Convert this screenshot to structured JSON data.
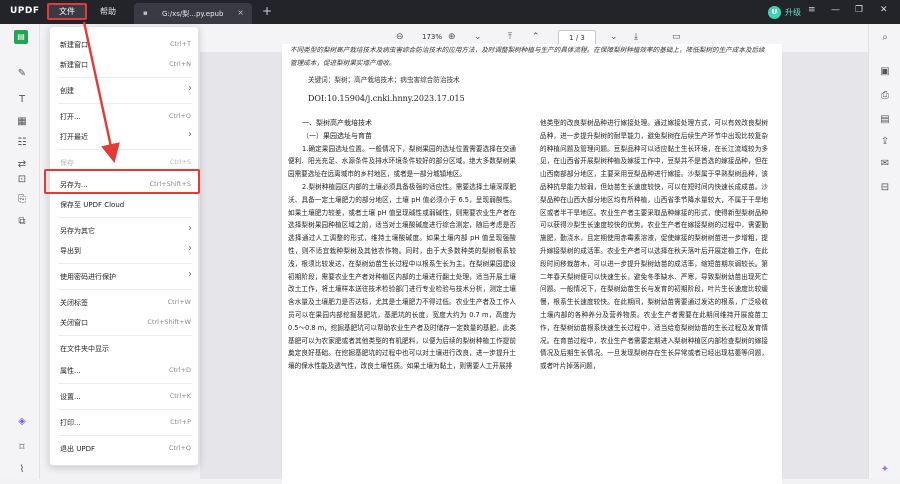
{
  "app": {
    "logo": "UPDF"
  },
  "menubar": {
    "file": "文件",
    "help": "帮助"
  },
  "tab": {
    "title": "G:/xs/梨...py.epub",
    "close": "×",
    "add": "+"
  },
  "account": {
    "initial": "U",
    "upgrade": "升级"
  },
  "toolbar": {
    "zoom": "173%",
    "page": "1  /  3"
  },
  "file_menu": {
    "items": [
      {
        "label": "新建窗口",
        "shortcut": "Ctrl+T"
      },
      {
        "label": "新建窗口",
        "shortcut": "Ctrl+N"
      },
      {
        "label": "创建",
        "shortcut": ""
      },
      {
        "label": "打开...",
        "shortcut": "Ctrl+O"
      },
      {
        "label": "打开最近",
        "shortcut": ""
      },
      {
        "label": "保存",
        "shortcut": "Ctrl+S"
      },
      {
        "label": "另存为...",
        "shortcut": "Ctrl+Shift+S"
      },
      {
        "label": "保存至 UPDF Cloud",
        "shortcut": ""
      },
      {
        "label": "另存为其它",
        "shortcut": ""
      },
      {
        "label": "导出到",
        "shortcut": ""
      },
      {
        "label": "使用密码进行保护",
        "shortcut": ""
      },
      {
        "label": "关闭标签",
        "shortcut": "Ctrl+W"
      },
      {
        "label": "关闭窗口",
        "shortcut": "Ctrl+Shift+W"
      },
      {
        "label": "在文件夹中显示",
        "shortcut": ""
      },
      {
        "label": "属性...",
        "shortcut": "Ctrl+D"
      },
      {
        "label": "设置...",
        "shortcut": "Ctrl+K"
      },
      {
        "label": "打印...",
        "shortcut": "Ctrl+P"
      },
      {
        "label": "退出 UPDF",
        "shortcut": "Ctrl+Q"
      }
    ]
  },
  "document": {
    "abstract": "不同类型的梨树高产栽培技术及病虫害综合防治技术的应用方法，及时调整梨树种植与生产的具体流程。在保障梨树种植效率的基础上，降低梨树的生产成本及后续管理成本，促进梨树果实增产增收。",
    "keywords": "关键词：梨树；高产栽培技术；病虫害综合防治技术",
    "doi": "DOI:10.15904/j.cnki.hnny.2023.17.015",
    "left_col": [
      "一、梨树高产栽培技术",
      "（一）果园选址与育苗",
      "1.确定果园选址位置。一般情况下，梨树果园的选址位置需要选择在交通便利、阳光充足、水源条件及排水环境条件较好的部分区域。绝大多数梨树果园需要选址在远离城市的乡村地区，或者是一部分城镇地区。",
      "2.梨树种植园区内部的土壤必须具备极强的适应性。需要选择土壤深厚肥沃、具备一定土壤肥力的部分地区，土壤 pH 值必须小于 6.5，呈现弱酸性。如果土壤肥力较差，或者土壤 pH 值呈现碱性或弱碱性，则需要农业生产者在选择梨树果园种植区域之前，适当对土壤酸碱度进行综合测定，随后考虑是否选择通过人工调整的形式，维持土壤酸碱度。如果土壤内部 pH 值呈现强酸性，则不适宜栽种梨树及其他农作物。同时，由于大多数种类的梨树根系较浅，根须比较发达，在梨树幼苗生长过程中以根系生长为主。在梨树果园建设初期阶段，需要农业生产者对种植区内部的土壤进行翻土处理，适当开展土壤改土工作，将土壤样本送往技术检验部门进行专业检验与技术分析，测定土壤含水量及土壤肥力是否达标，尤其是土壤肥力不得过低。农业生产者及工作人员可以在果园内部挖掘基肥坑，基肥坑的长度，宽度大约为 0.7 m，高度为 0.5～0.8 m，挖掘基肥坑可以帮助农业生产者及时储存一定数量的基肥，此类基肥可以为农家肥或者其他类型的有机肥料，以便为后续的梨树种植工作提前奠定良好基础。在挖掘基肥坑的过程中也可以对土壤进行改良，进一步提升土壤的保水性能及透气性，改良土壤性质。如果土壤为黏土，则需要人工开展排"
    ],
    "right_col": [
      "他类型的改良梨树品种进行嫁接处理。通过嫁接处理方式，可以有效改良梨树品种，进一步提升梨树的耐旱能力，避免梨树在后续生产环节中出现比较复杂的种植问题及管理问题。豆梨品种可以适应黏土生长环境，在长江流域较为多见，在山西省开展梨树种植及嫁接工作中，豆梨并不是首选的嫁接品种，但在山西南部部分地区，主要采用豆梨品种进行嫁接。沙梨属于早熟梨树品种，该品种抗旱能力较弱，但幼苗生长速度较快，可以在短时间内快速长成成苗。沙梨品种在山西大部分地区均有所种植，山西省季节降水量较大，不属于干旱地区或者半干旱地区。农业生产者主要采取品种嫁接的形式，使得新型梨树品种可以获得沙梨生长速度较快的优势。农业生产者在嫁接梨树的过程中，需要勤施肥，勤浇水，且定期使用赤霉素溶液，促使嫁接的梨树树苗进一步增粗，提升嫁接梨树的成活率。农业生产者可以选择在秋天落叶后开展定植工作，在此段时间移栽苗木，可以进一步提升梨树幼苗的成活率，缩短苗期灰弱较长。第二年春天梨树便可以快速生长，避免冬季缺水、严寒，导致梨树幼苗出现死亡问题。一般情况下，在梨树幼苗生长与发育的初期阶段，叶片生长速度比较缓慢，根系生长速度较快。在此期间，梨树幼苗需要通过发达的根系，广泛吸收土壤内部的各种养分及营养物质。农业生产者需要在此期间维持开展疫苗工作，在梨树幼苗根系快速生长过程中，适当给愈梨树幼苗的生长过程及发育情况。在育苗过程中，农业生产者需要定期进入梨树种植区内部检查梨树的嫁接情况及后期生长情况。一旦发现梨树存在生长异常或者已经出现枯萎等问题，或者叶片掉落问题，"
    ]
  }
}
